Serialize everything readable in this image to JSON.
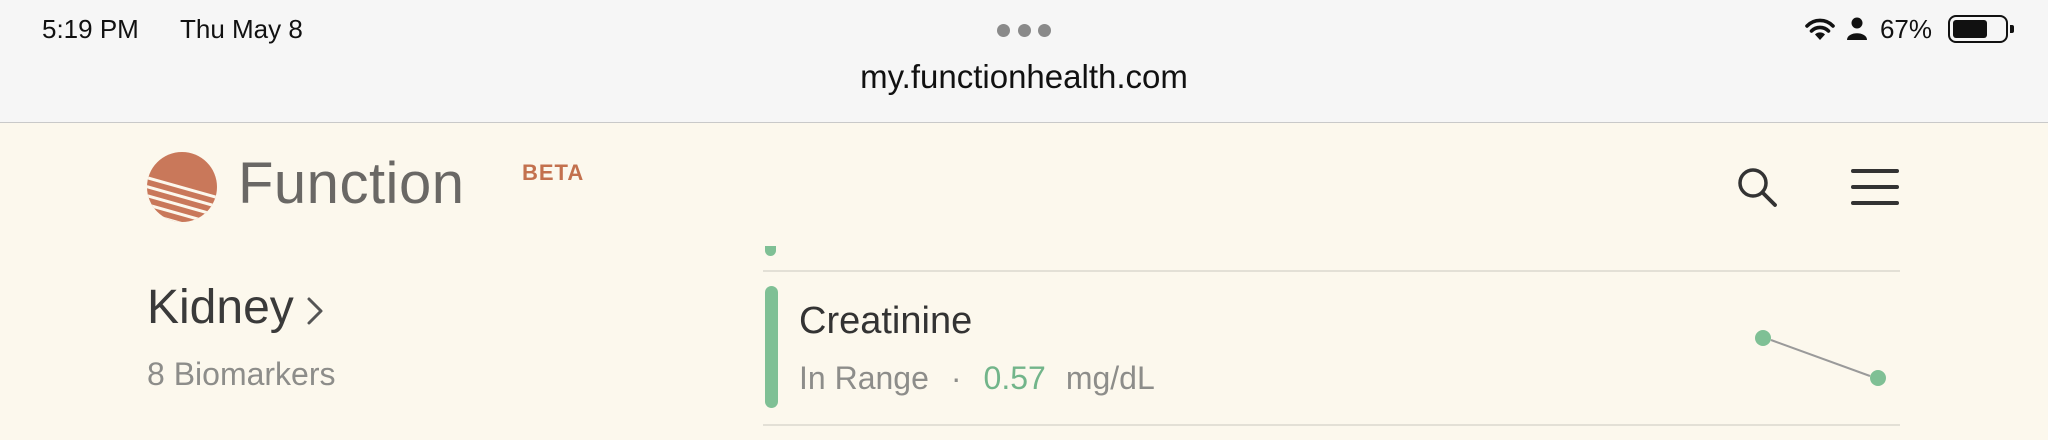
{
  "status_bar": {
    "time": "5:19 PM",
    "date": "Thu May 8",
    "battery_percent": "67%",
    "battery_level": 0.67
  },
  "browser": {
    "url": "my.functionhealth.com"
  },
  "header": {
    "brand": "Function",
    "badge": "BETA",
    "accent_color": "#c3714e"
  },
  "category": {
    "name": "Kidney",
    "count_label": "8 Biomarkers"
  },
  "biomarker": {
    "name": "Creatinine",
    "status": "In Range",
    "separator": "·",
    "value": "0.57",
    "unit": "mg/dL",
    "status_color": "#7fc095",
    "trend": [
      0.6,
      0.57
    ]
  },
  "icons": [
    "wifi-icon",
    "person-icon",
    "battery-icon",
    "search-icon",
    "menu-icon",
    "chevron-right-icon",
    "function-logo-icon"
  ]
}
